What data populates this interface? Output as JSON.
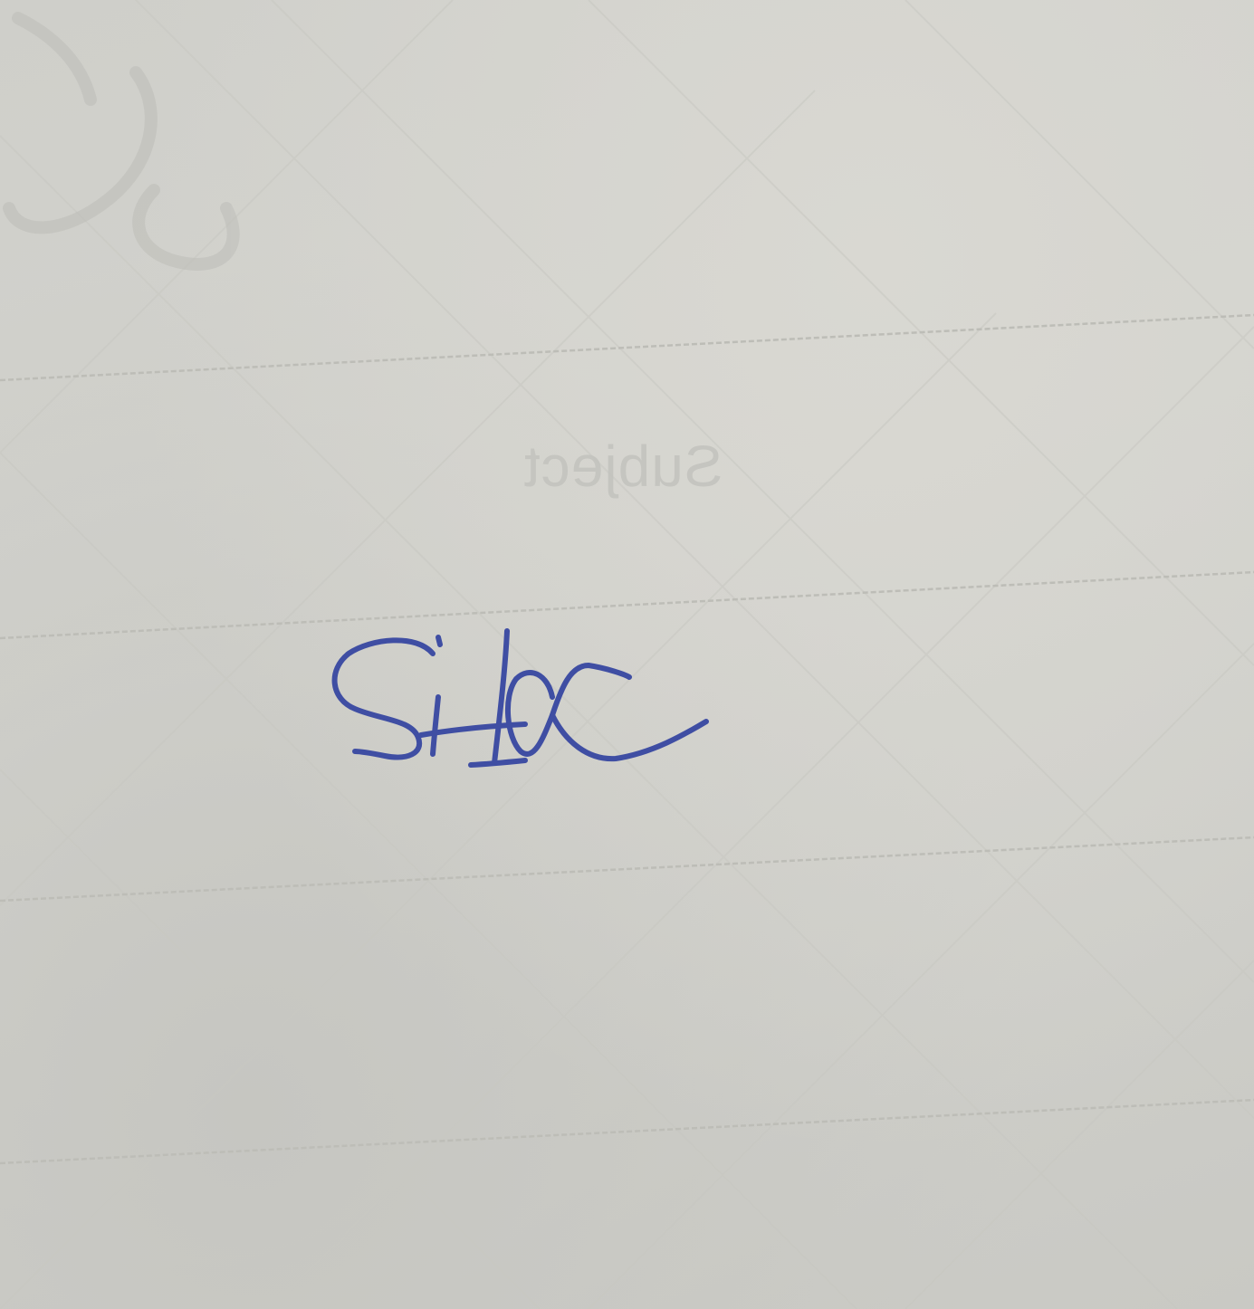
{
  "photo": {
    "signature_text": "Sita",
    "show_through_text": "Subject",
    "colors": {
      "paper": "#cfcfca",
      "ruled_line": "#bdbdb7",
      "ink": "#3f4ea3"
    }
  }
}
